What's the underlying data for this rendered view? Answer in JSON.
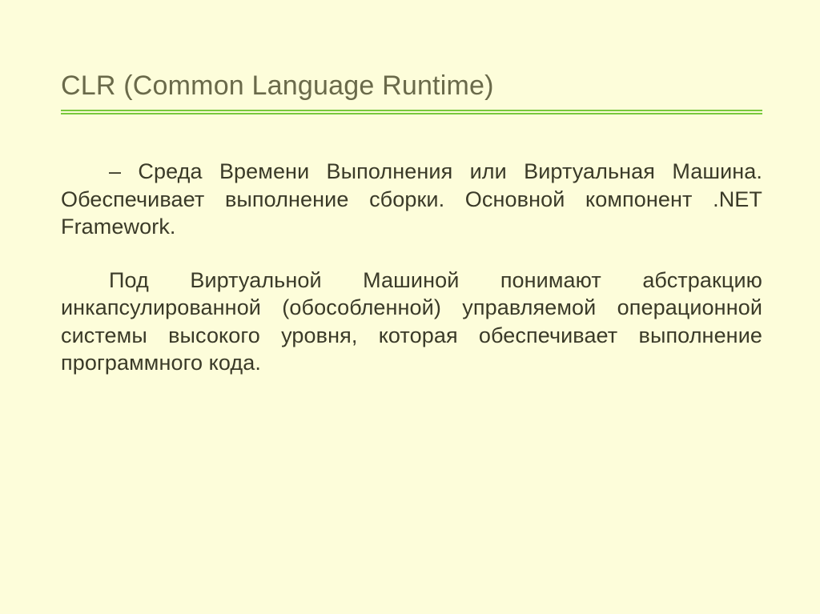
{
  "slide": {
    "title": "CLR (Common Language Runtime)",
    "paragraphs": {
      "p1": "– Среда Времени Выполнения или Виртуальная Машина. Обеспечивает выполнение сборки. Основной компонент .NET Framework.",
      "p2": "Под Виртуальной Машиной понимают абстракцию инкапсулированной (обособленной) управляемой операционной системы высокого уровня, которая обеспечивает выполнение программного кода."
    }
  }
}
